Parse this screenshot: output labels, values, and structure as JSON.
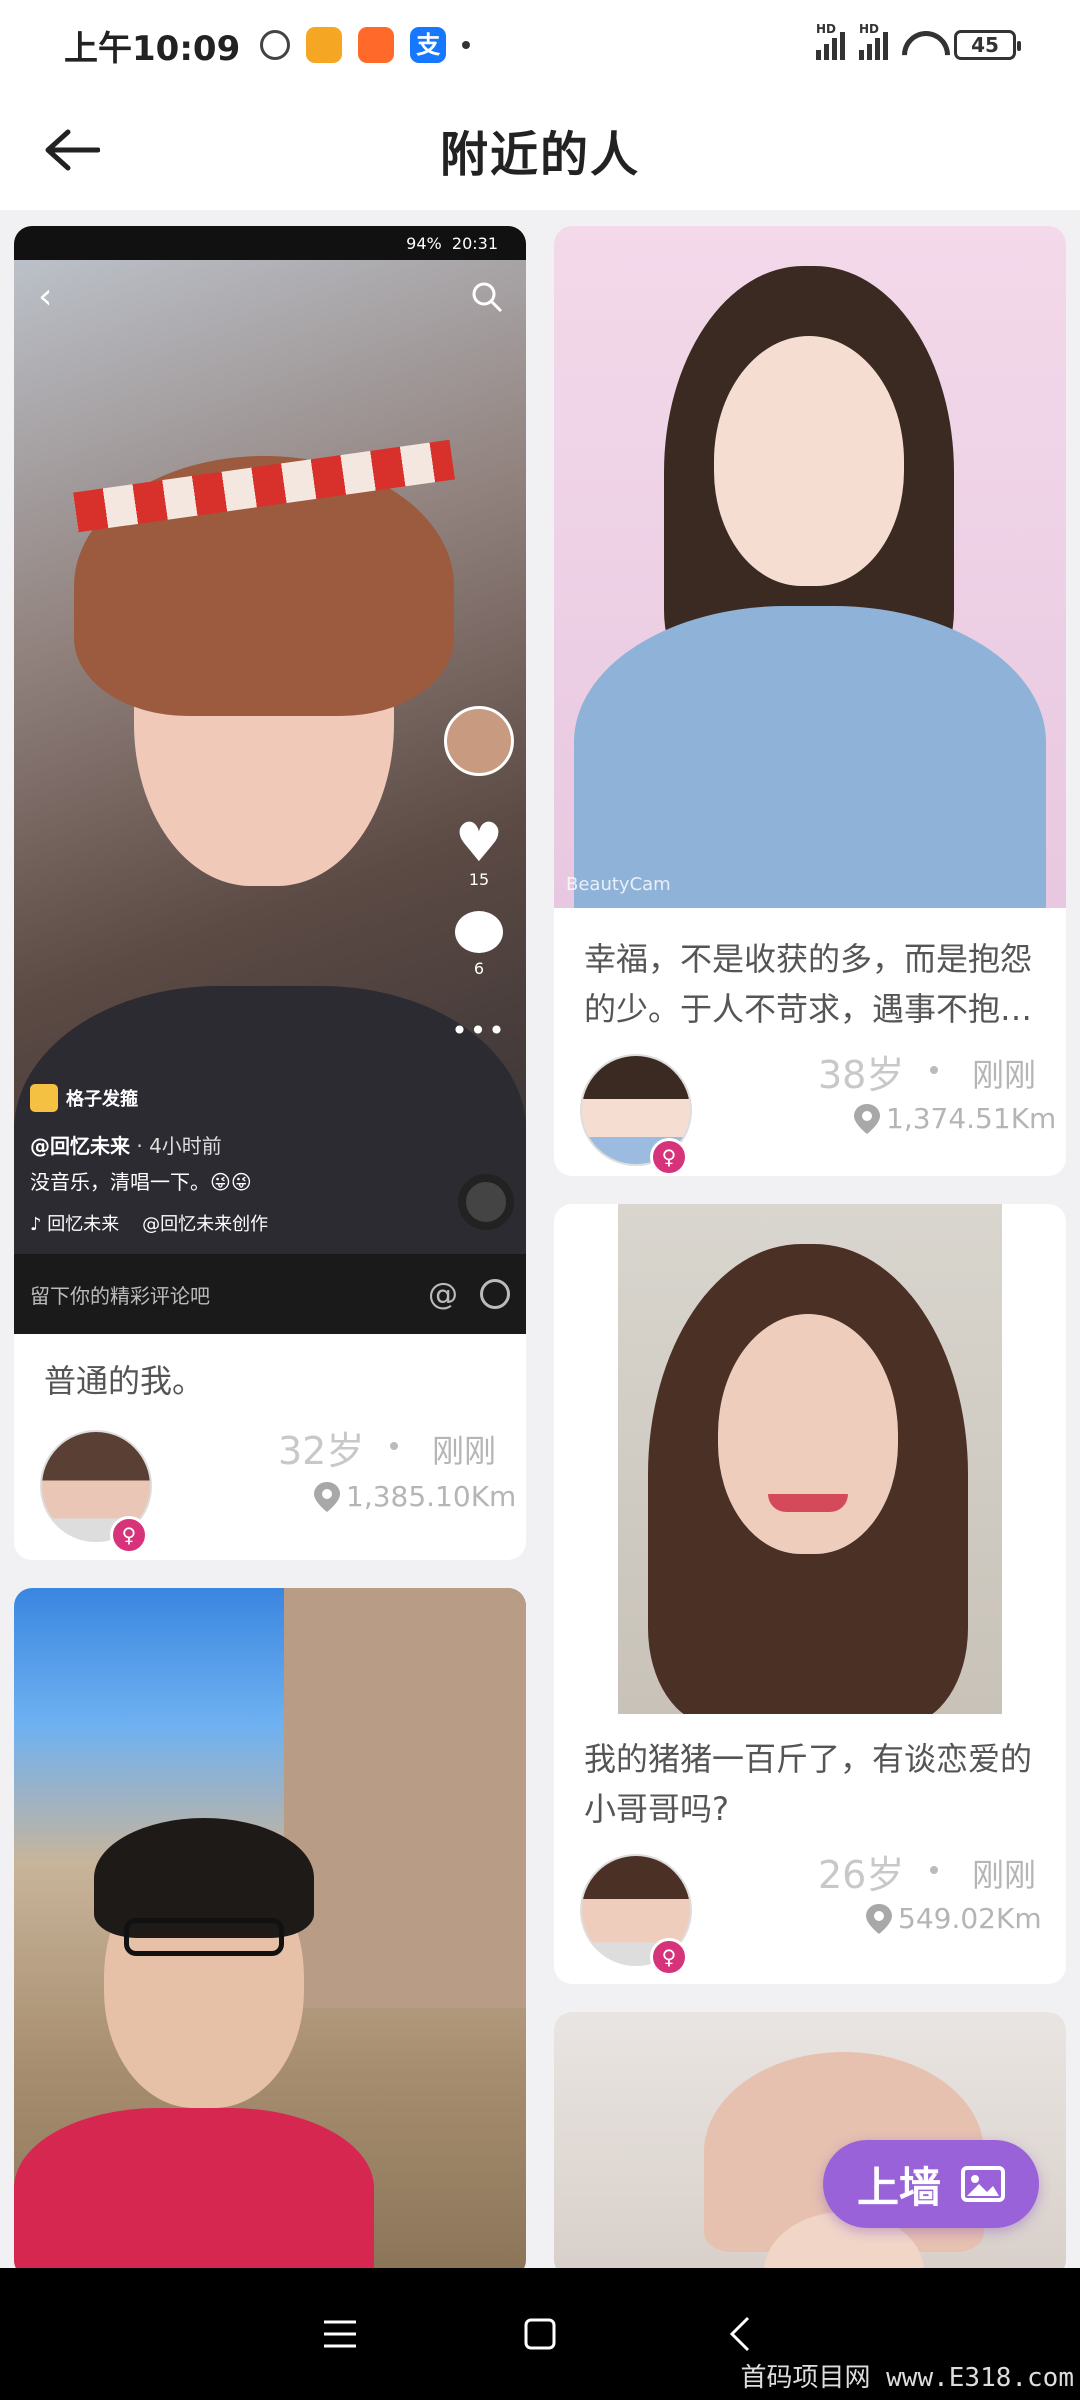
{
  "status_bar": {
    "time": "上午10:09",
    "battery": "45",
    "pay_icon_glyph": "支",
    "network_label": "HD"
  },
  "header": {
    "title": "附近的人"
  },
  "cards": [
    {
      "desc": "普通的我。",
      "age": "32岁",
      "time_ago": "刚刚",
      "distance": "1,385.10Km",
      "video": {
        "status_battery": "94%",
        "status_time": "20:31",
        "filter_tag": "格子发箍",
        "username": "@回忆未来",
        "posted": "· 4小时前",
        "caption": "没音乐，清唱一下。😜😜",
        "music": "♪ 回忆未来",
        "creator": "@回忆未来创作",
        "like_count": "15",
        "comment_count": "6",
        "comment_placeholder": "留下你的精彩评论吧"
      }
    },
    {
      "desc": "幸福，不是收获的多，而是抱怨的少。于人不苛求，遇事不抱…",
      "age": "38岁",
      "time_ago": "刚刚",
      "distance": "1,374.51Km",
      "photo_watermark": "BeautyCam"
    },
    {
      "desc": "我的猪猪一百斤了，有谈恋爱的小哥哥吗?",
      "age": "26岁",
      "time_ago": "刚刚",
      "distance": "549.02Km"
    }
  ],
  "fab": {
    "label": "上墙"
  },
  "watermark": "首码项目网 www.E318.com",
  "colors": {
    "accent": "#9a62d8",
    "female_badge": "#d6337a",
    "background": "#f1f1f3"
  }
}
